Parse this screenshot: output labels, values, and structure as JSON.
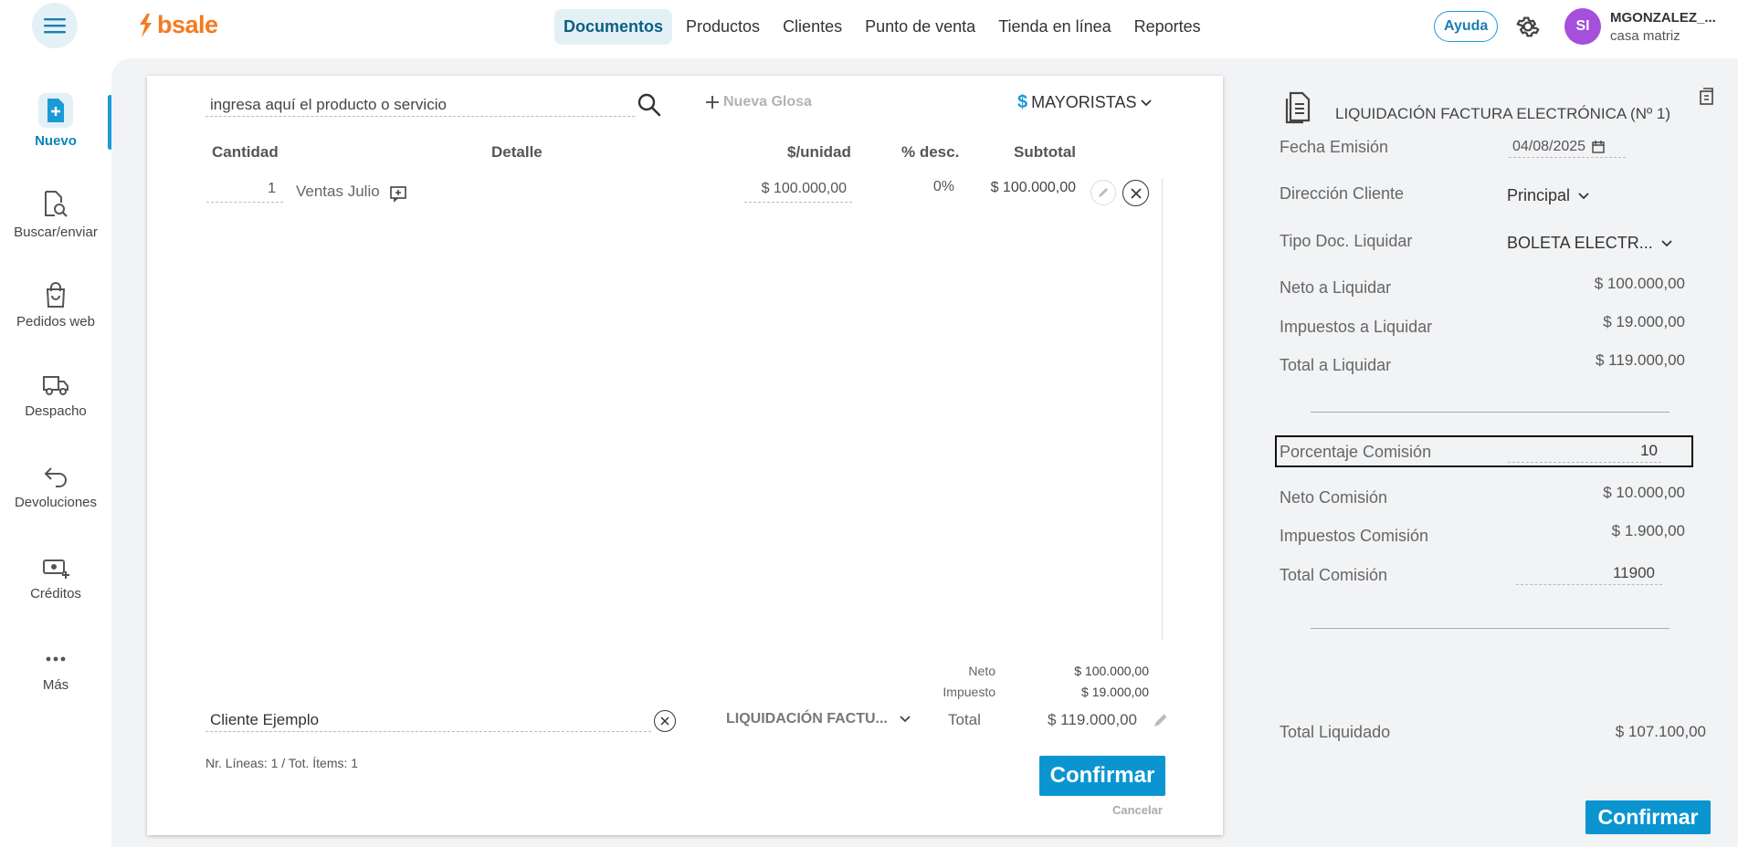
{
  "header": {
    "nav": [
      "Documentos",
      "Productos",
      "Clientes",
      "Punto de venta",
      "Tienda en línea",
      "Reportes"
    ],
    "logo_text": "bsale",
    "help_label": "Ayuda",
    "avatar_initials": "SI",
    "user_name": "MGONZALEZ_...",
    "user_branch": "casa matriz",
    "accent_color": "#1a9bd7",
    "brand_color": "#f47b20"
  },
  "sidebar": {
    "items": [
      {
        "label": "Nuevo",
        "icon": "new-document-icon"
      },
      {
        "label": "Buscar/enviar",
        "icon": "document-search-icon"
      },
      {
        "label": "Pedidos web",
        "icon": "shopping-bag-icon"
      },
      {
        "label": "Despacho",
        "icon": "truck-icon"
      },
      {
        "label": "Devoluciones",
        "icon": "return-arrow-icon"
      },
      {
        "label": "Créditos",
        "icon": "cash-plus-icon"
      },
      {
        "label": "Más",
        "icon": "more-dots-icon"
      }
    ]
  },
  "document": {
    "search_placeholder": "ingresa aquí el producto o servicio",
    "nueva_glosa": "Nueva Glosa",
    "price_list_symbol": "$",
    "price_list": "MAYORISTAS",
    "columns": {
      "quantity": "Cantidad",
      "detail": "Detalle",
      "unit_price": "$/unidad",
      "discount": "% desc.",
      "subtotal": "Subtotal"
    },
    "rows": [
      {
        "quantity": "1",
        "detail": "Ventas Julio",
        "unit_price": "$ 100.000,00",
        "discount": "0%",
        "subtotal": "$ 100.000,00"
      }
    ],
    "totals": {
      "neto_label": "Neto",
      "neto_value": "$ 100.000,00",
      "impuesto_label": "Impuesto",
      "impuesto_value": "$ 19.000,00",
      "total_label": "Total",
      "total_value": "$ 119.000,00"
    },
    "client_value": "Cliente Ejemplo",
    "doc_type": "LIQUIDACIÓN FACTU...",
    "lines_info": "Nr. Líneas: 1 / Tot. Ítems: 1",
    "confirm_label": "Confirmar",
    "cancel_label": "Cancelar"
  },
  "right_panel": {
    "title": "LIQUIDACIÓN FACTURA ELECTRÓNICA (Nº 1)",
    "fecha_label": "Fecha Emisión",
    "fecha_value": "04/08/2025",
    "direccion_label": "Dirección Cliente",
    "direccion_value": "Principal",
    "tipo_doc_label": "Tipo Doc. Liquidar",
    "tipo_doc_value": "BOLETA ELECTR...",
    "neto_liq_label": "Neto a Liquidar",
    "neto_liq_value": "$ 100.000,00",
    "imp_liq_label": "Impuestos a Liquidar",
    "imp_liq_value": "$ 19.000,00",
    "total_liq_label": "Total a Liquidar",
    "total_liq_value": "$ 119.000,00",
    "porc_comision_label": "Porcentaje Comisión",
    "porc_comision_value": "10",
    "neto_comision_label": "Neto Comisión",
    "neto_comision_value": "$ 10.000,00",
    "imp_comision_label": "Impuestos Comisión",
    "imp_comision_value": "$ 1.900,00",
    "total_comision_label": "Total Comisión",
    "total_comision_value": "11900",
    "total_liquidado_label": "Total Liquidado",
    "total_liquidado_value": "$ 107.100,00",
    "confirm_label": "Confirmar"
  }
}
